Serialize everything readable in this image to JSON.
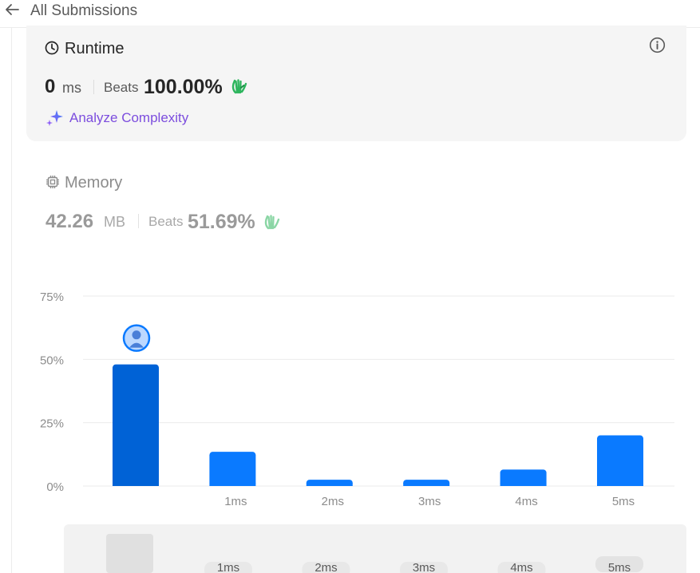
{
  "header": {
    "back_label": "All Submissions"
  },
  "runtime": {
    "title": "Runtime",
    "value": "0",
    "unit": "ms",
    "beats_label": "Beats",
    "beats_value": "100.00%",
    "analyze_label": "Analyze Complexity"
  },
  "memory": {
    "title": "Memory",
    "value": "42.26",
    "unit": "MB",
    "beats_label": "Beats",
    "beats_value": "51.69%"
  },
  "colors": {
    "bar": "#0a7aff",
    "bar_active": "#0062d6",
    "accent_green": "#2db55d",
    "analyze_purple": "#7c4dde"
  },
  "icons": {
    "back": "arrow-left-icon",
    "runtime": "clock-icon",
    "info": "info-icon",
    "analyze": "sparkle-icon",
    "memory": "chip-icon",
    "beats": "waving-hands-icon",
    "you": "user-avatar-icon"
  },
  "chart_data": {
    "type": "bar",
    "categories": [
      "",
      "1ms",
      "2ms",
      "3ms",
      "4ms",
      "5ms"
    ],
    "values": [
      48,
      13.5,
      2.5,
      2.5,
      6.5,
      20
    ],
    "yticks": [
      "0%",
      "25%",
      "50%",
      "75%"
    ],
    "ylim": [
      0,
      75
    ],
    "highlight_index": 0,
    "grid": true,
    "range_labels": [
      "1ms",
      "2ms",
      "3ms",
      "4ms",
      "5ms"
    ]
  }
}
